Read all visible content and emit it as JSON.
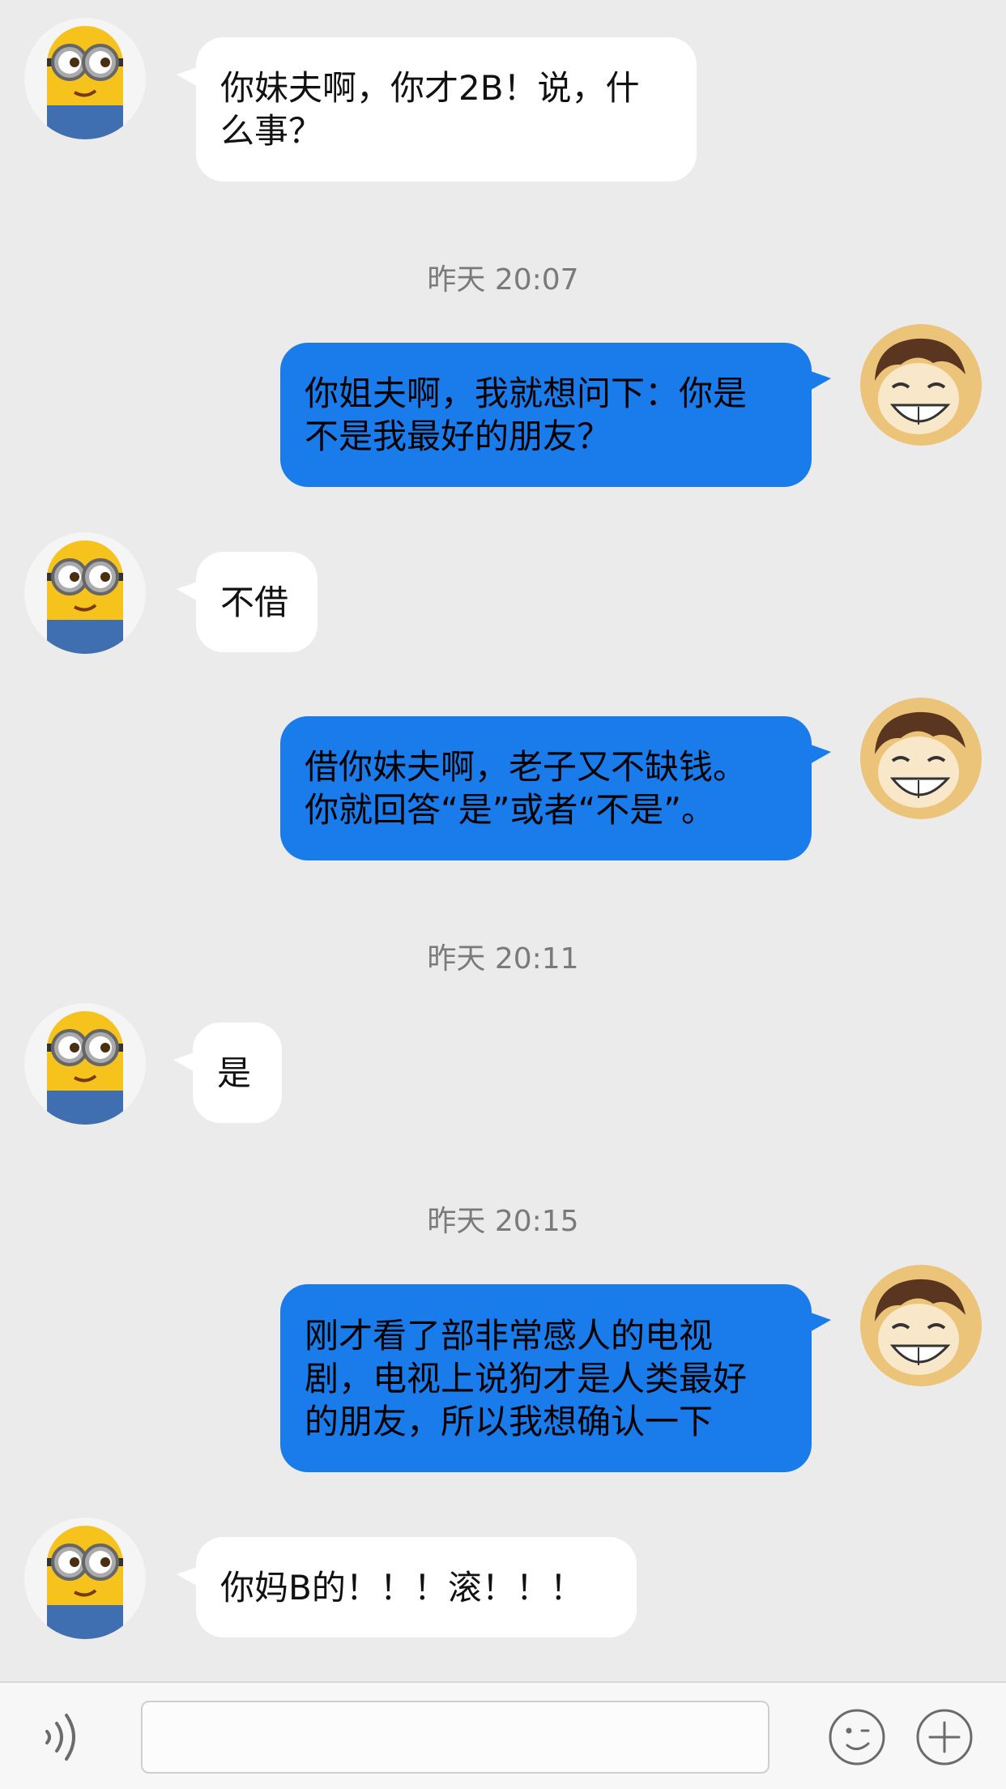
{
  "conversation": {
    "messages": [
      {
        "sender": "friend",
        "text": "你妹夫啊，你才2B！说，什\n么事？"
      },
      {
        "sender": "me",
        "text": "你姐夫啊，我就想问下：你是\n不是我最好的朋友？"
      },
      {
        "sender": "friend",
        "text": "不借"
      },
      {
        "sender": "me",
        "text": "借你妹夫啊，老子又不缺钱。\n你就回答“是”或者“不是”。"
      },
      {
        "sender": "friend",
        "text": "是"
      },
      {
        "sender": "me",
        "text": "刚才看了部非常感人的电视\n剧，电视上说狗才是人类最好\n的朋友，所以我想确认一下"
      },
      {
        "sender": "friend",
        "text": "你妈B的！！！滚！！！"
      }
    ],
    "timestamps": [
      "昨天 20:07",
      "昨天 20:11",
      "昨天 20:15"
    ]
  },
  "input_bar": {
    "voice_icon": "voice-icon",
    "emoji_icon": "emoji-icon",
    "more_icon": "plus-icon",
    "input_value": ""
  },
  "colors": {
    "background": "#ebebeb",
    "outgoing_bubble": "#1a7bea",
    "incoming_bubble": "#ffffff",
    "timestamp_text": "#7a7a7a"
  }
}
